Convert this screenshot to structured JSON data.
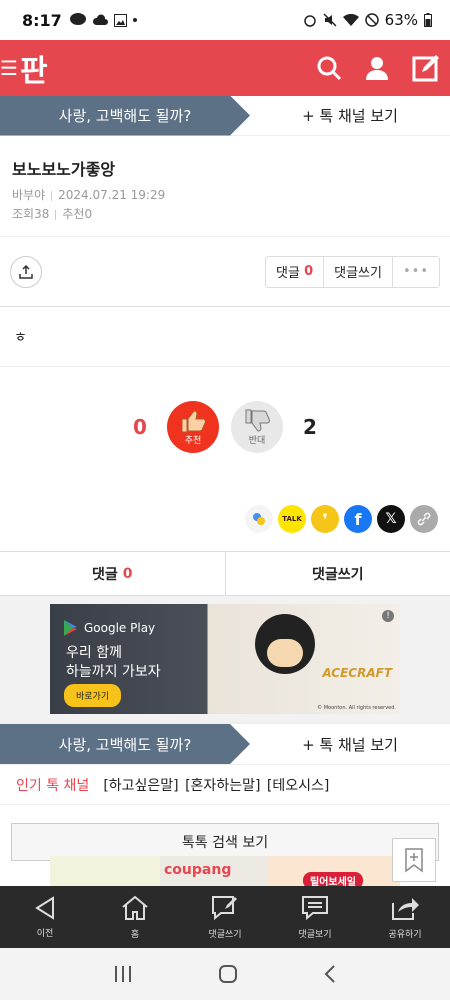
{
  "status": {
    "time": "8:17",
    "battery": "63%",
    "notif_icons": [
      "talk-icon",
      "cloud-icon",
      "image-icon"
    ]
  },
  "header": {
    "logo": "판",
    "colors": {
      "brand": "#e6474f"
    }
  },
  "channel": {
    "name": "사랑, 고백해도 될까?",
    "more_label": "+ 톡 채널 보기"
  },
  "post": {
    "title": "보노보노가좋앙",
    "author": "바부야",
    "date": "2024.07.21 19:29",
    "views_label": "조회38",
    "recommend_label": "추천0",
    "body": "ㅎ"
  },
  "actions": {
    "comment_label": "댓글",
    "comment_count": "0",
    "write_label": "댓글쓰기",
    "more_label": "•••"
  },
  "vote": {
    "up_count": "0",
    "up_label": "추천",
    "down_label": "반대",
    "down_count": "2"
  },
  "comment_bar": {
    "comments_label": "댓글",
    "comments_count": "0",
    "write_label": "댓글쓰기"
  },
  "ad": {
    "store": "Google Play",
    "copy_line1": "우리 함께",
    "copy_line2": "하늘까지 가보자",
    "cta": "바로가기",
    "brand": "ACECRAFT",
    "copyright": "© Moonton. All rights reserved."
  },
  "channel2": {
    "name": "사랑, 고백해도 될까?",
    "more_label": "+ 톡 채널 보기"
  },
  "popular": {
    "label": "인기 톡 채널",
    "tags": [
      "[하고싶은말]",
      "[혼자하는말]",
      "[테오시스]"
    ]
  },
  "search_button": "톡톡 검색 보기",
  "products": {
    "p2_text": "coupang",
    "p3_badge": "릴어보세일"
  },
  "bottom_nav": [
    {
      "label": "이전",
      "icon": "back-icon"
    },
    {
      "label": "홈",
      "icon": "home-icon"
    },
    {
      "label": "댓글쓰기",
      "icon": "write-comment-icon"
    },
    {
      "label": "댓글보기",
      "icon": "view-comment-icon"
    },
    {
      "label": "공유하기",
      "icon": "share-icon"
    }
  ]
}
